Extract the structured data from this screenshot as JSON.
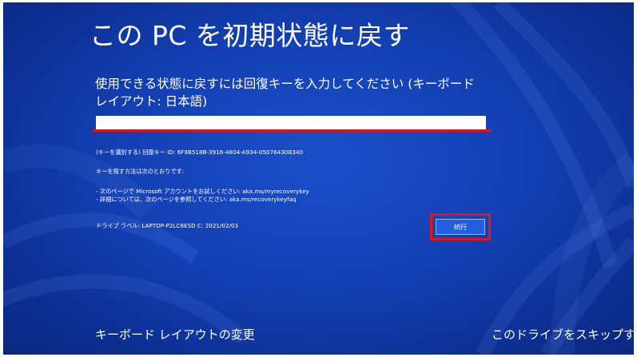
{
  "title": "この PC を初期状態に戻す",
  "prompt": "使用できる状態に戻すには回復キーを入力してください (キーボード レイアウト: 日本語)",
  "recovery_key_input": {
    "value": "",
    "placeholder": ""
  },
  "key_id_line": "(キーを識別する) 回復キー ID: 6F9B518B-3916-4804-A934-05076430B340",
  "how_to_find_heading": "キーを探す方法は次のとおりです:",
  "instructions": [
    "- 次のページで Microsoft アカウントをお試しください: aka.ms/myrecoverykey",
    "- 詳細については、次のページを参照してください: aka.ms/recoverykeyfaq"
  ],
  "drive_label_line": "ドライブ ラベル: LAPTOP-P2LC6ESD C: 2021/02/03",
  "continue_button": "続行",
  "footer": {
    "change_keyboard_layout": "キーボード レイアウトの変更",
    "skip_drive": "このドライブをスキップする"
  },
  "colors": {
    "background": "#1440b4",
    "highlight": "#e01515",
    "button": "#1f5fe0"
  }
}
